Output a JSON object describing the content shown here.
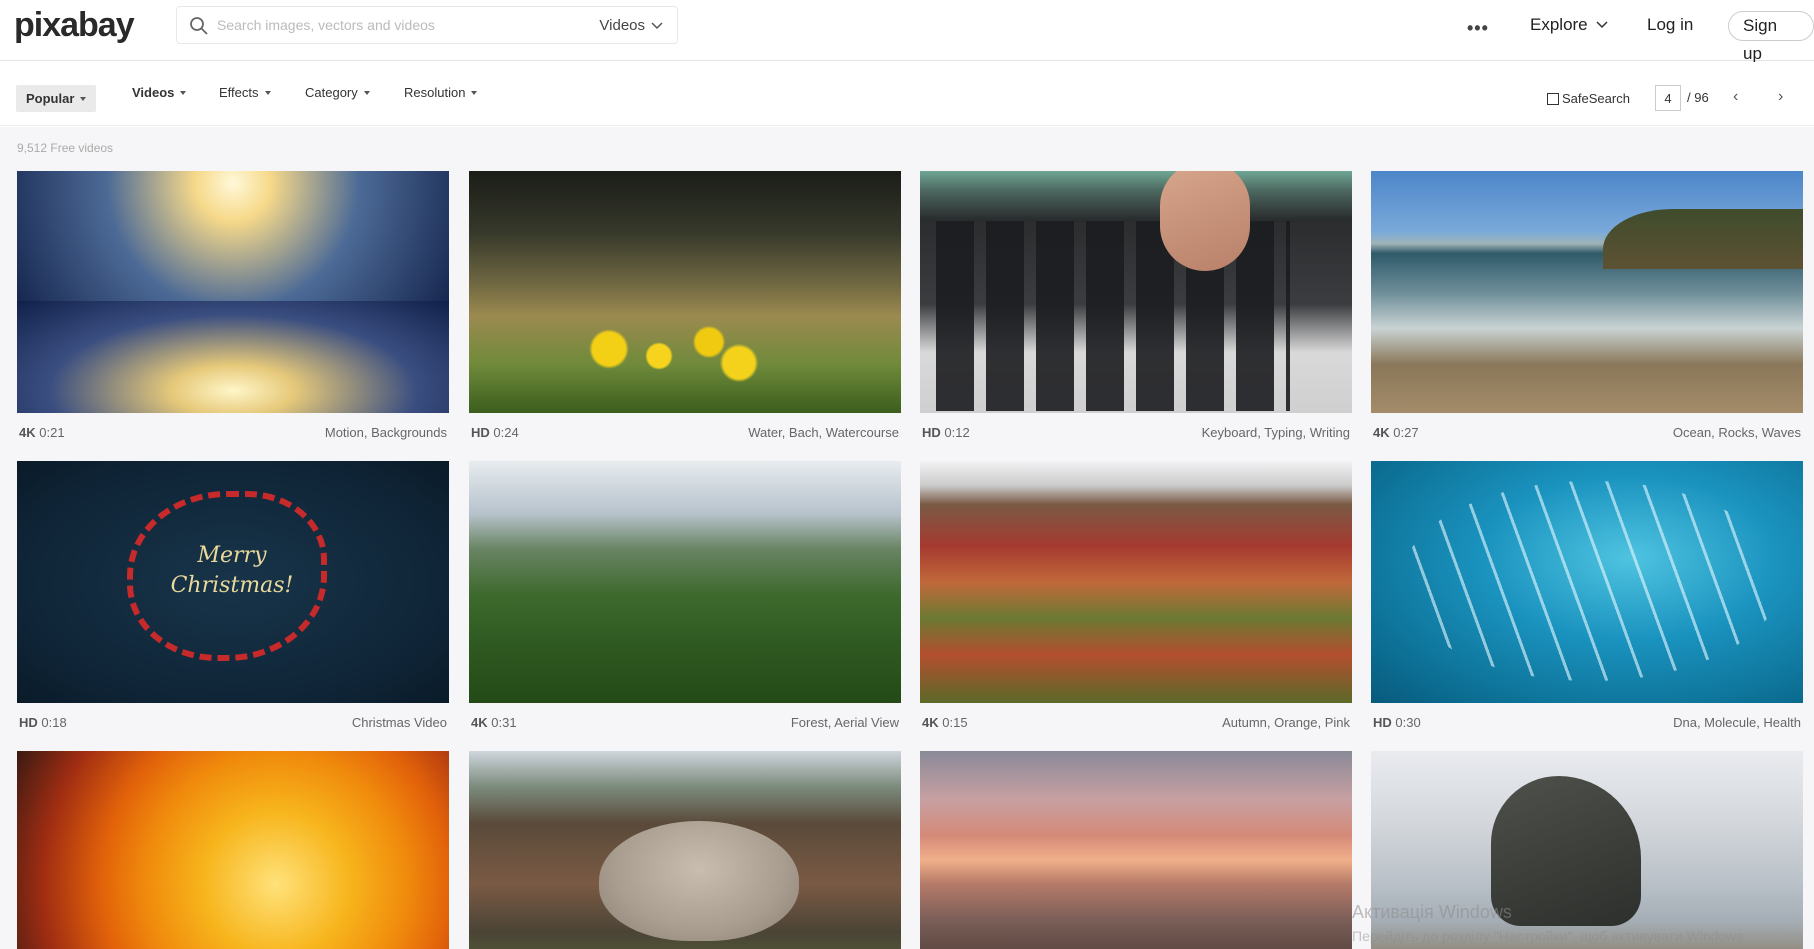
{
  "header": {
    "logo": "pixabay",
    "search": {
      "placeholder": "Search images, vectors and videos",
      "type": "Videos"
    },
    "more": "•••",
    "explore": "Explore",
    "login": "Log in",
    "signup": "Sign up"
  },
  "filters": {
    "popular": "Popular",
    "videos": "Videos",
    "effects": "Effects",
    "category": "Category",
    "resolution": "Resolution",
    "safesearch": "SafeSearch",
    "page_current": "4",
    "page_total": "/ 96",
    "prev": "‹",
    "next": "›"
  },
  "count": "9,512 Free videos",
  "videos": [
    {
      "quality": "4K",
      "duration": "0:21",
      "tags": "Motion, Backgrounds"
    },
    {
      "quality": "HD",
      "duration": "0:24",
      "tags": "Water, Bach, Watercourse"
    },
    {
      "quality": "HD",
      "duration": "0:12",
      "tags": "Keyboard, Typing, Writing"
    },
    {
      "quality": "4K",
      "duration": "0:27",
      "tags": "Ocean, Rocks, Waves"
    },
    {
      "quality": "HD",
      "duration": "0:18",
      "tags": "Christmas Video",
      "overlay_text": "Merry Christmas!"
    },
    {
      "quality": "4K",
      "duration": "0:31",
      "tags": "Forest, Aerial View"
    },
    {
      "quality": "4K",
      "duration": "0:15",
      "tags": "Autumn, Orange, Pink"
    },
    {
      "quality": "HD",
      "duration": "0:30",
      "tags": "Dna, Molecule, Health"
    },
    {
      "quality": "",
      "duration": "",
      "tags": ""
    },
    {
      "quality": "",
      "duration": "",
      "tags": ""
    },
    {
      "quality": "",
      "duration": "",
      "tags": ""
    },
    {
      "quality": "",
      "duration": "",
      "tags": ""
    }
  ],
  "watermark": {
    "line1": "Активація Windows",
    "line2": "Перейдіть до розділу \"Настройки\", щоб активувати Windows."
  }
}
